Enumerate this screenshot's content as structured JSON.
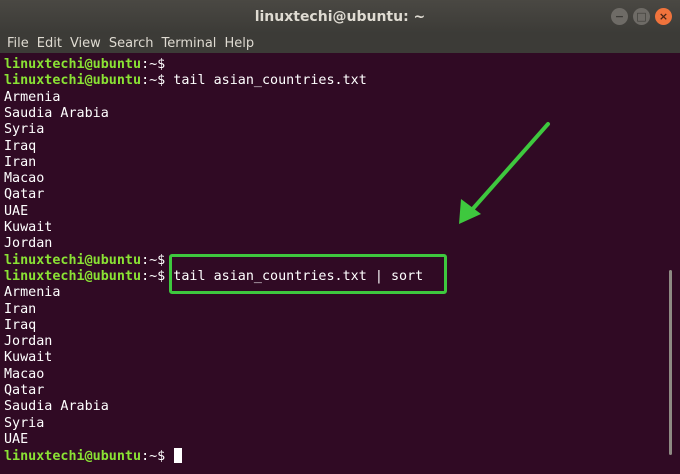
{
  "window": {
    "title": "linuxtechi@ubuntu: ~",
    "controls": [
      "−",
      "□",
      "×"
    ]
  },
  "menubar": [
    "File",
    "Edit",
    "View",
    "Search",
    "Terminal",
    "Help"
  ],
  "terminal": {
    "prompt_user": "linuxtechi@ubuntu",
    "prompt_sep": ":~$",
    "lines": [
      {
        "kind": "prompt",
        "cmd": ""
      },
      {
        "kind": "prompt",
        "cmd": " tail asian_countries.txt"
      },
      {
        "kind": "output",
        "text": "Armenia"
      },
      {
        "kind": "output",
        "text": "Saudia Arabia"
      },
      {
        "kind": "output",
        "text": "Syria"
      },
      {
        "kind": "output",
        "text": "Iraq"
      },
      {
        "kind": "output",
        "text": "Iran"
      },
      {
        "kind": "output",
        "text": "Macao"
      },
      {
        "kind": "output",
        "text": "Qatar"
      },
      {
        "kind": "output",
        "text": "UAE"
      },
      {
        "kind": "output",
        "text": "Kuwait"
      },
      {
        "kind": "output",
        "text": "Jordan"
      },
      {
        "kind": "prompt",
        "cmd": ""
      },
      {
        "kind": "prompt",
        "cmd": " tail asian_countries.txt | sort"
      },
      {
        "kind": "output",
        "text": "Armenia"
      },
      {
        "kind": "output",
        "text": "Iran"
      },
      {
        "kind": "output",
        "text": "Iraq"
      },
      {
        "kind": "output",
        "text": "Jordan"
      },
      {
        "kind": "output",
        "text": "Kuwait"
      },
      {
        "kind": "output",
        "text": "Macao"
      },
      {
        "kind": "output",
        "text": "Qatar"
      },
      {
        "kind": "output",
        "text": "Saudia Arabia"
      },
      {
        "kind": "output",
        "text": "Syria"
      },
      {
        "kind": "output",
        "text": "UAE"
      },
      {
        "kind": "prompt",
        "cmd": " ",
        "cursor": true
      }
    ]
  },
  "colors": {
    "background": "#300a24",
    "prompt": "#8ae234",
    "text": "#ffffff",
    "annotation": "#3ec83e"
  }
}
